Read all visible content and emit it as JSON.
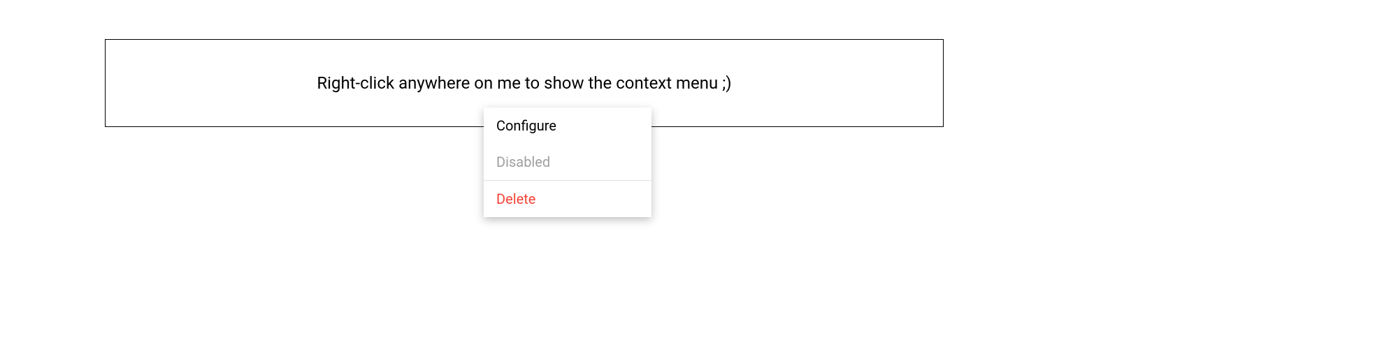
{
  "panel": {
    "instruction": "Right-click anywhere on me to show the context menu ;)"
  },
  "contextMenu": {
    "items": {
      "configure": "Configure",
      "disabled": "Disabled",
      "delete": "Delete"
    }
  }
}
